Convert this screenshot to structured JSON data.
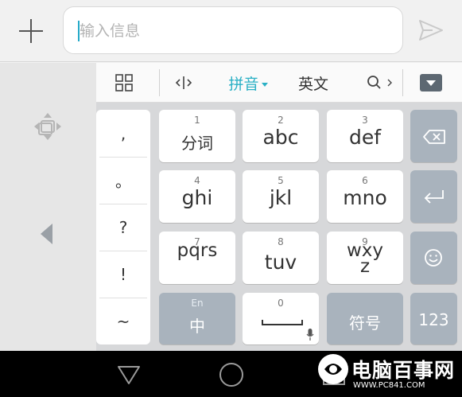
{
  "compose": {
    "placeholder": "输入信息"
  },
  "toolbar": {
    "pinyin_label": "拼音",
    "english_label": "英文"
  },
  "punctuation": [
    ",",
    "。",
    "?",
    "!",
    "~"
  ],
  "keys": [
    {
      "num": "1",
      "label": "分词"
    },
    {
      "num": "2",
      "label": "abc"
    },
    {
      "num": "3",
      "label": "def"
    },
    {
      "num": "4",
      "label": "ghi"
    },
    {
      "num": "5",
      "label": "jkl"
    },
    {
      "num": "6",
      "label": "mno"
    },
    {
      "num": "7",
      "label": "pqrs"
    },
    {
      "num": "8",
      "label": "tuv"
    },
    {
      "num": "9",
      "label": "wxyz"
    }
  ],
  "bottom": {
    "zh_top": "En",
    "zh_label": "中",
    "space_num": "0",
    "symbols_label": "符号",
    "numeric_label": "123"
  },
  "watermark": {
    "text": "电脑百事网",
    "url": "WWW.PC841.COM"
  },
  "colors": {
    "accent": "#2ab0c5",
    "function_key": "#a9b3bd",
    "nav_bar": "#000000"
  }
}
